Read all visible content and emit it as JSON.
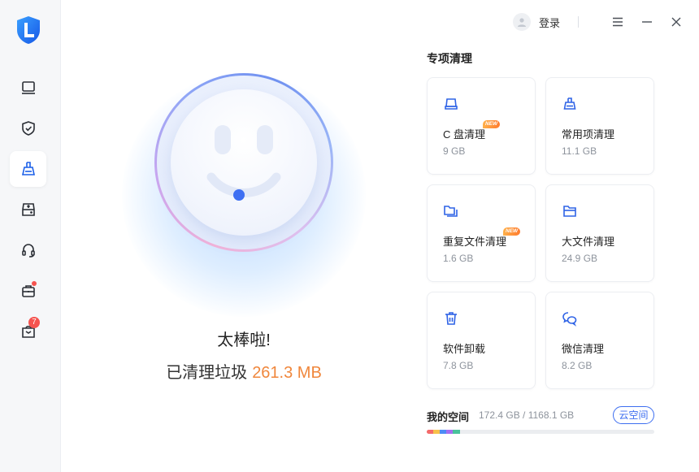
{
  "app": {
    "brand_color": "#1a73e8",
    "accent": "#3d6ef0",
    "highlight": "#f0873c"
  },
  "sidebar": {
    "items": [
      {
        "icon": "computer-icon",
        "active": false
      },
      {
        "icon": "shield-check-icon",
        "active": false
      },
      {
        "icon": "broom-icon",
        "active": true
      },
      {
        "icon": "hard-drive-icon",
        "active": false
      },
      {
        "icon": "headset-icon",
        "active": false
      },
      {
        "icon": "toolbox-icon",
        "active": false,
        "dot": true
      },
      {
        "icon": "gift-bag-icon",
        "active": false,
        "badge": "7"
      }
    ]
  },
  "topbar": {
    "login_label": "登录",
    "menu_icon": "menu-icon",
    "minimize_icon": "minimize-icon",
    "close_icon": "close-icon"
  },
  "hero": {
    "title": "太棒啦!",
    "cleaned_label": "已清理垃圾",
    "cleaned_value": "261.3 MB"
  },
  "special_clean": {
    "title": "专项清理",
    "cards": [
      {
        "icon": "drive-icon",
        "label": "C 盘清理",
        "size": "9 GB",
        "new_tag": "NEW"
      },
      {
        "icon": "broom-icon",
        "label": "常用项清理",
        "size": "11.1 GB"
      },
      {
        "icon": "duplicate-files-icon",
        "label": "重复文件清理",
        "size": "1.6 GB",
        "new_tag": "NEW"
      },
      {
        "icon": "folder-icon",
        "label": "大文件清理",
        "size": "24.9 GB"
      },
      {
        "icon": "trash-icon",
        "label": "软件卸载",
        "size": "7.8 GB"
      },
      {
        "icon": "wechat-icon",
        "label": "微信清理",
        "size": "8.2 GB"
      }
    ]
  },
  "storage": {
    "label": "我的空间",
    "value": "172.4 GB / 1168.1 GB",
    "cloud_button": "云空间",
    "used_fraction": 0.1476
  }
}
